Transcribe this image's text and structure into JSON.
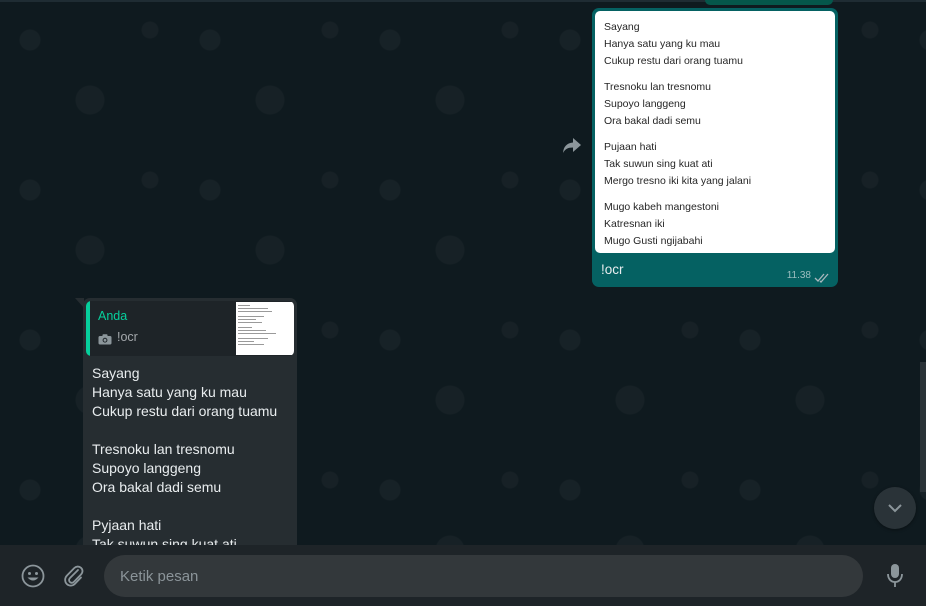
{
  "outgoing_message": {
    "image_text_lines": [
      "Sayang",
      "Hanya satu yang ku mau",
      "Cukup restu dari orang tuamu",
      "Tresnoku lan tresnomu",
      "Supoyo langgeng",
      "Ora bakal dadi semu",
      "Pujaan hati",
      "Tak suwun sing kuat ati",
      "Mergo tresno iki kita yang jalani",
      "Mugo kabeh mangestoni",
      "Katresnan iki",
      "Mugo Gusti ngijabahi"
    ],
    "caption": "!ocr",
    "time": "11.38",
    "status_icon": "double-check-icon"
  },
  "incoming_message": {
    "quote": {
      "author": "Anda",
      "text": "!ocr",
      "icon": "camera-icon"
    },
    "body": "Sayang\nHanya satu yang ku mau\nCukup restu dari orang tuamu\n\nTresnoku lan tresnomu\nSupoyo langgeng\nOra bakal dadi semu\n\nPyjaan hati\nTak suwun sing kuat ati"
  },
  "composer": {
    "placeholder": "Ketik pesan"
  },
  "colors": {
    "background": "#0d1418",
    "outgoing_bubble": "#056162",
    "incoming_bubble": "#262d31",
    "accent": "#06cf9c"
  }
}
